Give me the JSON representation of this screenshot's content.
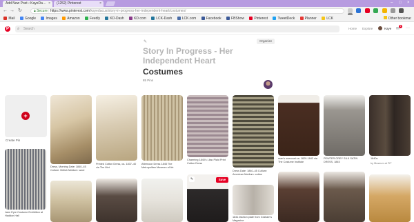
{
  "browser": {
    "tabs": [
      {
        "title": "Add New Post ‹ KayeDa…"
      },
      {
        "title": "(1252) Pinterest"
      }
    ],
    "url_secure": "Secure",
    "url_host": "https://www.pinterest.com",
    "url_path": "/kayedacus/story-in-progress-her-independent-heart/costumes/",
    "bookmarks": [
      "Mail",
      "Google",
      "Images",
      "Amazon",
      "Feedly",
      "KD-Dash",
      "KD.com",
      "LCK-Dash",
      "LCK.com",
      "Facebook",
      "FBShow",
      "Pinterest",
      "TweetDeck",
      "Planner",
      "LCK"
    ],
    "other_bookmarks": "Other bookmar"
  },
  "pinterest": {
    "search_placeholder": "Search",
    "nav_home": "Home",
    "nav_explore": "Explore",
    "nav_user": "Kaye",
    "notif_count": "1",
    "dots": "···"
  },
  "board": {
    "organize": "Organize",
    "title_line1": "Story In Progress - Her Independent Heart",
    "title_line2": "Costumes",
    "pin_count": "85 Pins"
  },
  "create_pin": "Create Pin",
  "save_label": "Save",
  "pins": {
    "p1": "Dress, Morning Date: 1840–45 Culture: British Medium: wool",
    "p2": "Printed Cotton Dress, ca. 1837–40 via The Met",
    "p3": "Afternoon Dress 1845 The Metropolitan Museum of Art",
    "p4": "Charming 1840's Lilac Plaid Print Cotton Dress",
    "p5": "Dress Date: 1840–45 Culture: American Medium: cotton",
    "p6": "man's overcoat ca. 1829-1842 via The Costume Institute",
    "p7": "PEWTER GREY SILK SATIN DRESS, 1845",
    "p8": "1840s",
    "p8b": "by Museum at FIT",
    "p9": "Jane Eyre Costume Exhibition at Haddon Hall",
    "p10": "1841 fashion plate from Graham's Magazine"
  }
}
